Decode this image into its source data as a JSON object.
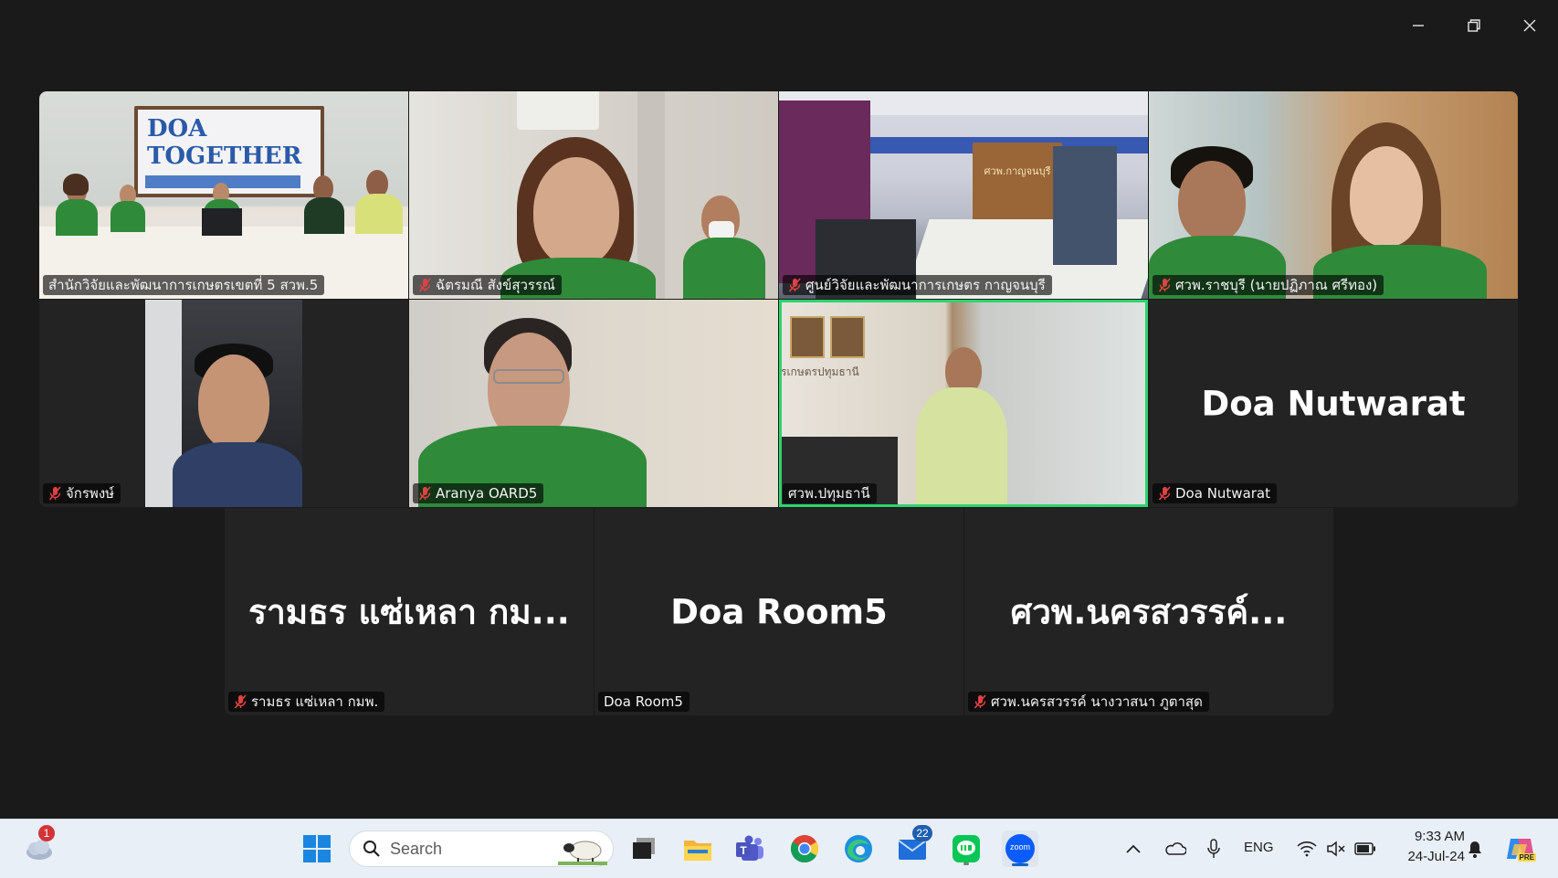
{
  "window": {
    "controls": {
      "minimize": "minimize-icon",
      "maximize": "restore-icon",
      "close": "close-icon"
    }
  },
  "gallery": {
    "tiles": [
      {
        "name": "สำนักวิจัยและพัฒนาการเกษตรเขตที่ 5 สวพ.5",
        "muted": false,
        "video": "conference-room",
        "poster_text": "DOA TOGETHER"
      },
      {
        "name": "ฉัตรมณี สังข์สุวรรณ์",
        "muted": true,
        "video": "woman-closeup"
      },
      {
        "name": "ศูนย์วิจัยและพัฒนาการเกษตร กาญจนบุรี",
        "muted": true,
        "video": "meeting-hall",
        "sign_text": "ศวพ.กาญจนบุรี"
      },
      {
        "name": "ศวพ.ราชบุรี (นายปฏิภาณ ศรีทอง)",
        "muted": true,
        "video": "two-people"
      },
      {
        "name": "จักรพงษ์",
        "muted": true,
        "video": "man-in-car"
      },
      {
        "name": "Aranya OARD5",
        "muted": true,
        "video": "woman-glasses"
      },
      {
        "name": "ศวพ.ปทุมธานี",
        "muted": false,
        "active_speaker": true,
        "video": "office-standing",
        "wall_text": "รเกษตรปทุมธานี"
      },
      {
        "name": "Doa Nutwarat",
        "muted": true,
        "display_name": "Doa Nutwarat"
      },
      {
        "name": "รามธร แซ่เหลา กมพ.",
        "muted": true,
        "display_name": "รามธร แซ่เหลา กม..."
      },
      {
        "name": "Doa Room5",
        "muted": false,
        "display_name": "Doa Room5"
      },
      {
        "name": "ศวพ.นครสวรรค์ นางวาสนา ภูตาสุด",
        "muted": true,
        "display_name": "ศวพ.นครสวรรค์..."
      }
    ]
  },
  "taskbar": {
    "weather_badge": "1",
    "search_placeholder": "Search",
    "mail_badge": "22",
    "apps": [
      "windows-start-icon",
      "task-view-icon",
      "file-explorer-icon",
      "teams-icon",
      "chrome-icon",
      "edge-icon",
      "mail-icon",
      "line-icon",
      "zoom-icon"
    ],
    "zoom_label": "zoom",
    "tray": {
      "language": "ENG",
      "time": "9:33 AM",
      "date": "24-Jul-24",
      "copilot_tag": "PRE"
    }
  },
  "colors": {
    "active_speaker": "#2dd36f",
    "tile_bg": "#232323",
    "taskbar_bg": "#e9eff7",
    "zoom_blue": "#0b5cff"
  }
}
